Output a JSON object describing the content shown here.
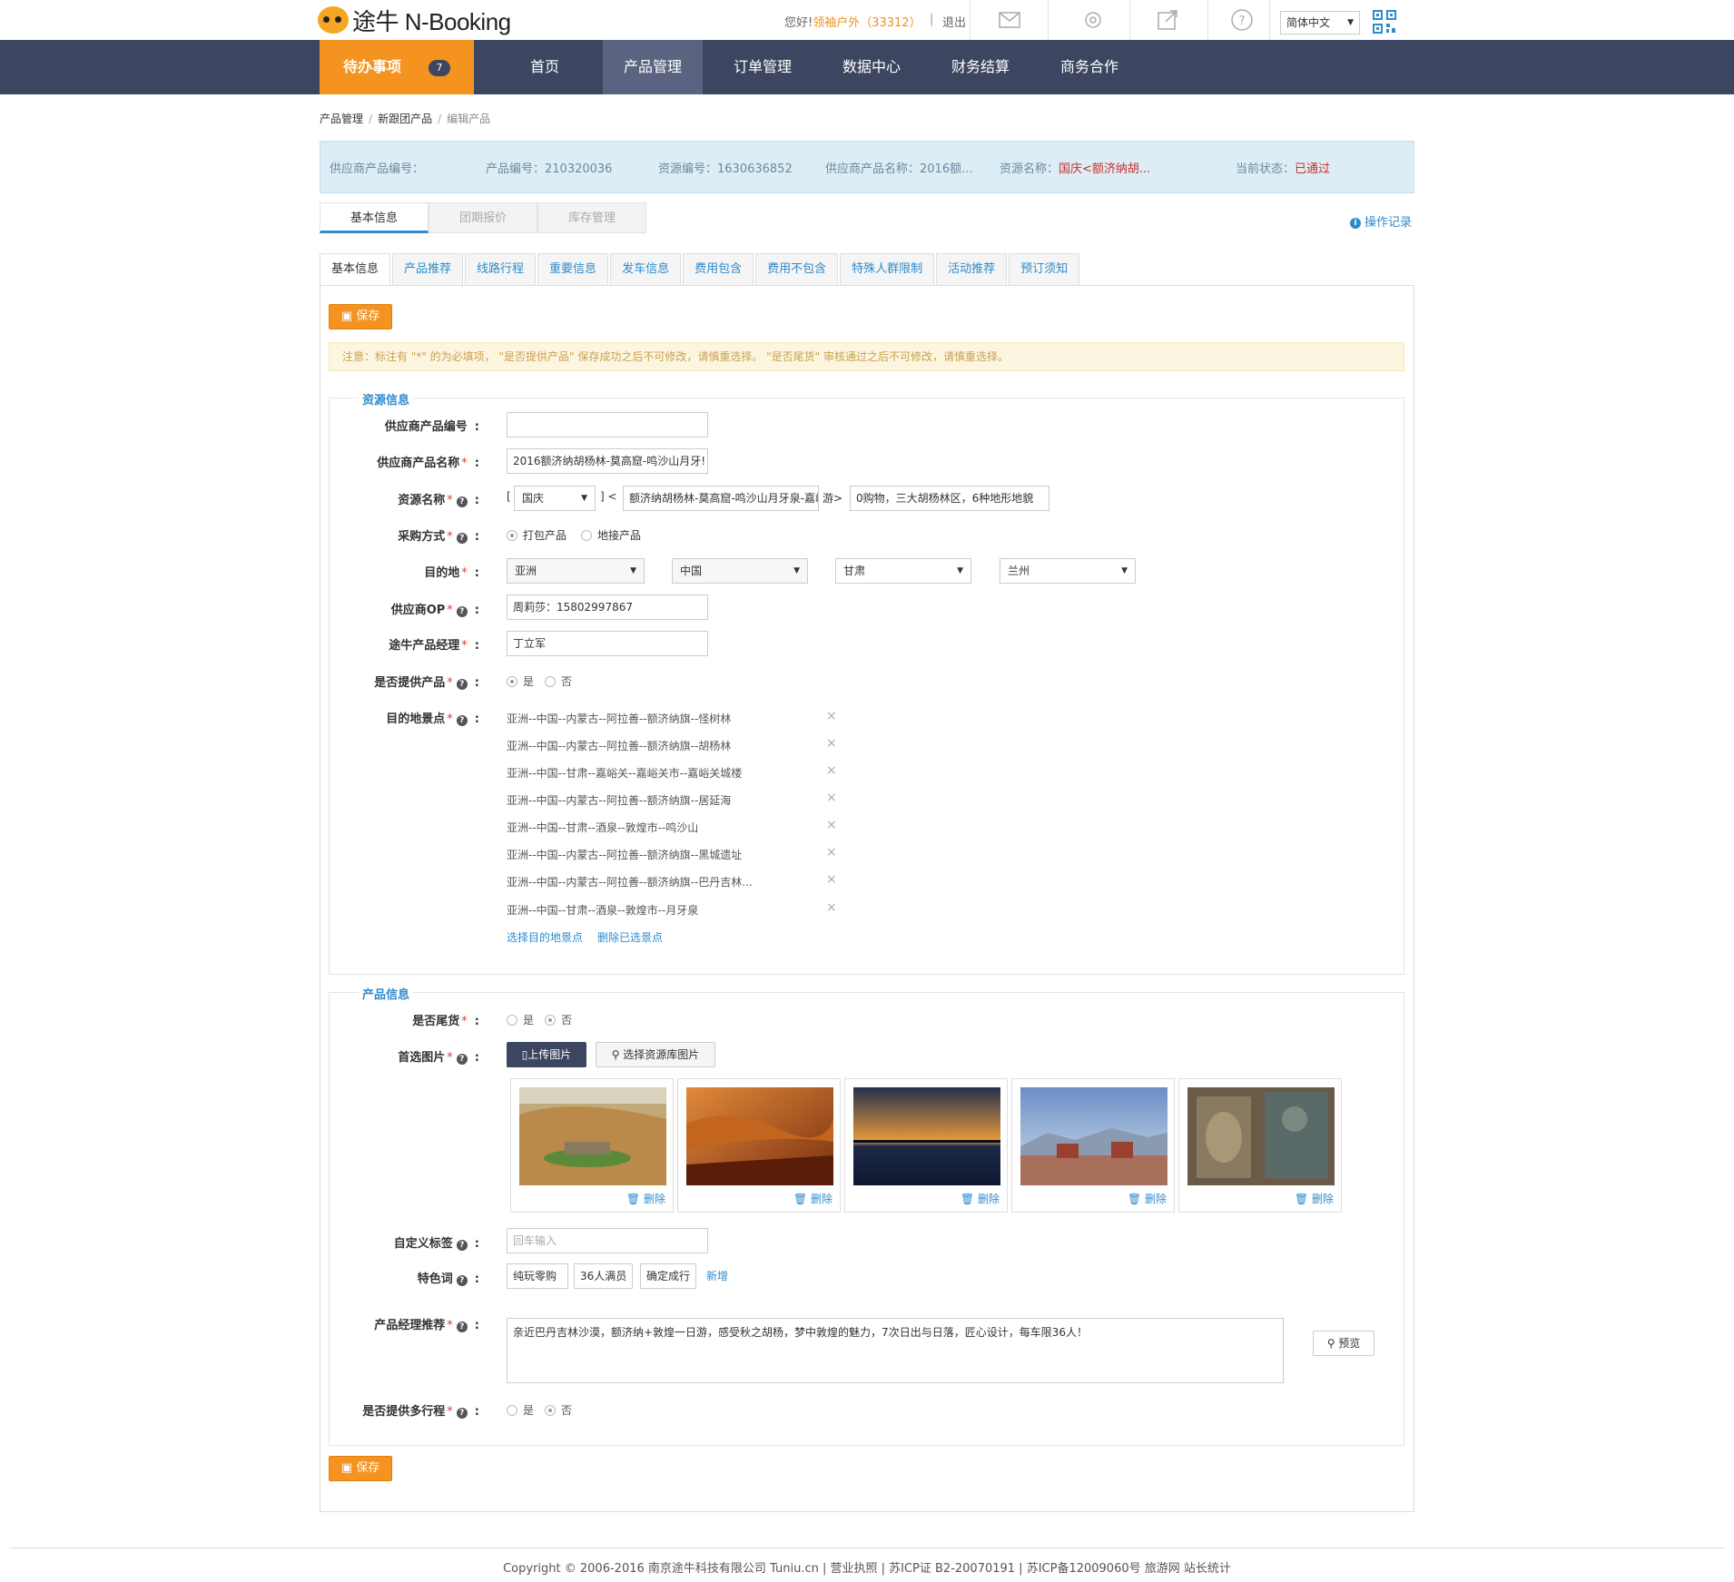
{
  "header": {
    "logo_text": "途牛 N-Booking",
    "greeting": "您好!",
    "user": "领袖户外（33312）",
    "logout": "退出",
    "language": "简体中文"
  },
  "nav": {
    "todo_label": "待办事项",
    "todo_count": "7",
    "items": [
      "首页",
      "产品管理",
      "订单管理",
      "数据中心",
      "财务结算",
      "商务合作"
    ]
  },
  "breadcrumb": [
    "产品管理",
    "新跟团产品",
    "编辑产品"
  ],
  "info_bar": {
    "supplier_code": "供应商产品编号：",
    "product_code": "产品编号：210320036",
    "resource_code": "资源编号：1630636852",
    "supplier_name_label": "供应商产品名称：",
    "supplier_name_value": "2016额...",
    "resource_name_label": "资源名称：",
    "resource_name_value": "国庆<额济纳胡...",
    "status_label": "当前状态：",
    "status_value": "已通过"
  },
  "main_tabs": [
    "基本信息",
    "团期报价",
    "库存管理"
  ],
  "op_log": "操作记录",
  "sub_tabs": [
    "基本信息",
    "产品推荐",
    "线路行程",
    "重要信息",
    "发车信息",
    "费用包含",
    "费用不包含",
    "特殊人群限制",
    "活动推荐",
    "预订须知"
  ],
  "save_label": "保存",
  "notice": "注意：标注有 \"*\" 的为必填项，        \"是否提供产品\" 保存成功之后不可修改，请慎重选择。        \"是否尾货\" 审核通过之后不可修改，请慎重选择。",
  "resource_section": {
    "legend": "资源信息",
    "supplier_code_label": "供应商产品编号",
    "supplier_code_value": "",
    "supplier_name_label": "供应商产品名称",
    "supplier_name_value": "2016额济纳胡杨林-莫高窟-鸣沙山月牙!",
    "resource_name_label": "资源名称",
    "resource_prefix_open": "[",
    "resource_holiday": "国庆",
    "resource_prefix_close": "] <",
    "resource_route": "额济纳胡杨林-莫高窟-鸣沙山月牙泉-嘉峪",
    "resource_mid": "游>",
    "resource_desc": "0购物，三大胡杨林区，6种地形地貌",
    "purchase_label": "采购方式",
    "purchase_opt1": "打包产品",
    "purchase_opt2": "地接产品",
    "dest_label": "目的地",
    "dest": [
      "亚洲",
      "中国",
      "甘肃",
      "兰州"
    ],
    "op_label": "供应商OP",
    "op_value": "周莉莎：15802997867",
    "manager_label": "途牛产品经理",
    "manager_value": "丁立军",
    "provide_label": "是否提供产品",
    "provide_yes": "是",
    "provide_no": "否",
    "spots_label": "目的地景点",
    "spots": [
      "亚洲--中国--内蒙古--阿拉善--额济纳旗--怪树林",
      "亚洲--中国--内蒙古--阿拉善--额济纳旗--胡杨林",
      "亚洲--中国--甘肃--嘉峪关--嘉峪关市--嘉峪关城楼",
      "亚洲--中国--内蒙古--阿拉善--额济纳旗--居延海",
      "亚洲--中国--甘肃--酒泉--敦煌市--鸣沙山",
      "亚洲--中国--内蒙古--阿拉善--额济纳旗--黑城遗址",
      "亚洲--中国--内蒙古--阿拉善--额济纳旗--巴丹吉林...",
      "亚洲--中国--甘肃--酒泉--敦煌市--月牙泉"
    ],
    "select_spots": "选择目的地景点",
    "delete_spots": "删除已选景点"
  },
  "product_section": {
    "legend": "产品信息",
    "tail_label": "是否尾货",
    "tail_yes": "是",
    "tail_no": "否",
    "image_label": "首选图片",
    "upload_btn": "上传图片",
    "library_btn": "选择资源库图片",
    "delete_label": "删除",
    "tag_label": "自定义标签",
    "tag_placeholder": "回车输入",
    "feature_label": "特色词",
    "features": [
      "纯玩零购物",
      "36人满员",
      "确定成行"
    ],
    "add_feature": "新增",
    "recommend_label": "产品经理推荐",
    "recommend_text": "亲近巴丹吉林沙漠，额济纳+敦煌一日游，感受秋之胡杨，梦中敦煌的魅力，7次日出与日落，匠心设计，每车限36人！",
    "preview_btn": "预览",
    "multi_label": "是否提供多行程",
    "multi_yes": "是",
    "multi_no": "否"
  },
  "footer": "Copyright © 2006-2016 南京途牛科技有限公司 Tuniu.cn | 营业执照 | 苏ICP证 B2-20070191 | 苏ICP备12009060号 旅游网 站长统计",
  "colors": {
    "nav_bg": "#3d4660",
    "accent_orange": "#f49320",
    "link_blue": "#2e8bcc",
    "info_bg": "#dcedf5"
  }
}
